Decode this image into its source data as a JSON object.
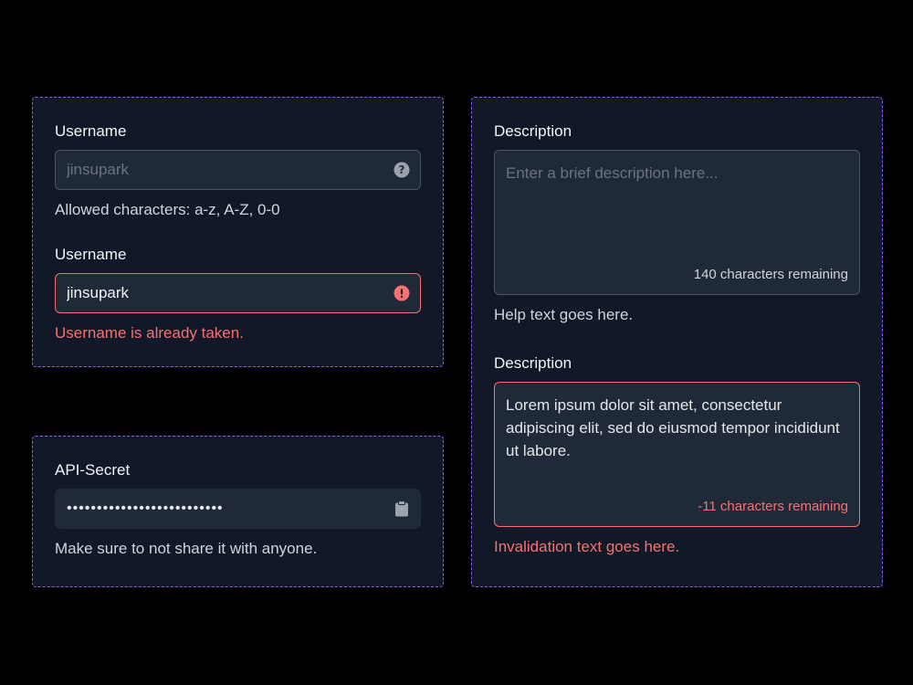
{
  "username_panel": {
    "field1": {
      "label": "Username",
      "placeholder": "jinsupark",
      "help": "Allowed characters: a-z, A-Z, 0-0",
      "icon": "help-circle-icon"
    },
    "field2": {
      "label": "Username",
      "value": "jinsupark",
      "error": "Username is already taken.",
      "icon": "alert-circle-icon"
    }
  },
  "secret_panel": {
    "label": "API-Secret",
    "value": "••••••••••••••••••••••••••",
    "help": "Make sure to not share it with anyone.",
    "icon": "clipboard-icon"
  },
  "description_panel": {
    "field1": {
      "label": "Description",
      "placeholder": "Enter a brief description here...",
      "counter": "140 characters remaining",
      "help": "Help text goes here."
    },
    "field2": {
      "label": "Description",
      "value": "Lorem ipsum dolor sit amet, consectetur adipiscing elit, sed do eiusmod tempor incididunt ut labore.",
      "counter": "-11 characters remaining",
      "error": "Invalidation text goes here."
    }
  },
  "colors": {
    "background": "#000000",
    "panel": "#111827",
    "panel_border": "#8b5cf6",
    "input_bg": "#1f2937",
    "input_border": "#4b5563",
    "error": "#f87171",
    "placeholder": "#6b7280"
  }
}
